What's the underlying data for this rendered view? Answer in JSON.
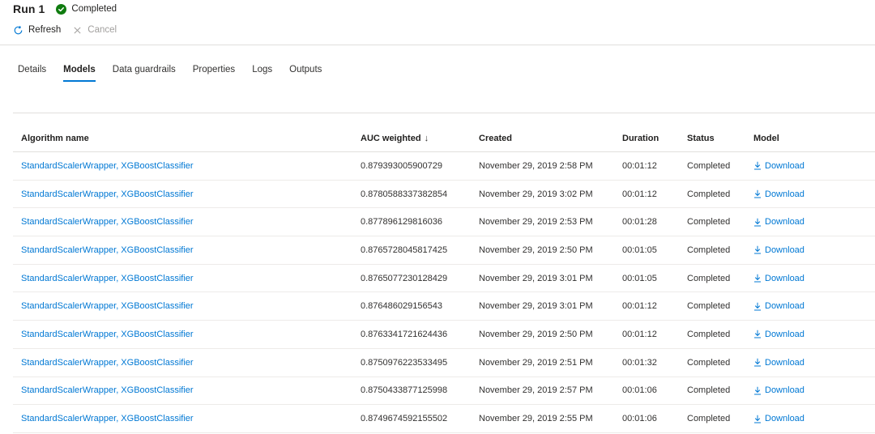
{
  "header": {
    "title": "Run 1",
    "status_label": "Completed",
    "status_color": "#107c10"
  },
  "toolbar": {
    "refresh_label": "Refresh",
    "cancel_label": "Cancel"
  },
  "tabs": [
    {
      "label": "Details",
      "active": false
    },
    {
      "label": "Models",
      "active": true
    },
    {
      "label": "Data guardrails",
      "active": false
    },
    {
      "label": "Properties",
      "active": false
    },
    {
      "label": "Logs",
      "active": false
    },
    {
      "label": "Outputs",
      "active": false
    }
  ],
  "table": {
    "columns": {
      "algorithm": "Algorithm name",
      "auc": "AUC weighted",
      "auc_sort_icon": "arrow-down-icon",
      "created": "Created",
      "duration": "Duration",
      "status": "Status",
      "model": "Model"
    },
    "download_icon": "download-icon",
    "rows": [
      {
        "algorithm": "StandardScalerWrapper, XGBoostClassifier",
        "auc": "0.879393005900729",
        "created": "November 29, 2019 2:58 PM",
        "duration": "00:01:12",
        "status": "Completed",
        "model": "Download"
      },
      {
        "algorithm": "StandardScalerWrapper, XGBoostClassifier",
        "auc": "0.8780588337382854",
        "created": "November 29, 2019 3:02 PM",
        "duration": "00:01:12",
        "status": "Completed",
        "model": "Download"
      },
      {
        "algorithm": "StandardScalerWrapper, XGBoostClassifier",
        "auc": "0.877896129816036",
        "created": "November 29, 2019 2:53 PM",
        "duration": "00:01:28",
        "status": "Completed",
        "model": "Download"
      },
      {
        "algorithm": "StandardScalerWrapper, XGBoostClassifier",
        "auc": "0.8765728045817425",
        "created": "November 29, 2019 2:50 PM",
        "duration": "00:01:05",
        "status": "Completed",
        "model": "Download"
      },
      {
        "algorithm": "StandardScalerWrapper, XGBoostClassifier",
        "auc": "0.8765077230128429",
        "created": "November 29, 2019 3:01 PM",
        "duration": "00:01:05",
        "status": "Completed",
        "model": "Download"
      },
      {
        "algorithm": "StandardScalerWrapper, XGBoostClassifier",
        "auc": "0.876486029156543",
        "created": "November 29, 2019 3:01 PM",
        "duration": "00:01:12",
        "status": "Completed",
        "model": "Download"
      },
      {
        "algorithm": "StandardScalerWrapper, XGBoostClassifier",
        "auc": "0.8763341721624436",
        "created": "November 29, 2019 2:50 PM",
        "duration": "00:01:12",
        "status": "Completed",
        "model": "Download"
      },
      {
        "algorithm": "StandardScalerWrapper, XGBoostClassifier",
        "auc": "0.8750976223533495",
        "created": "November 29, 2019 2:51 PM",
        "duration": "00:01:32",
        "status": "Completed",
        "model": "Download"
      },
      {
        "algorithm": "StandardScalerWrapper, XGBoostClassifier",
        "auc": "0.8750433877125998",
        "created": "November 29, 2019 2:57 PM",
        "duration": "00:01:06",
        "status": "Completed",
        "model": "Download"
      },
      {
        "algorithm": "StandardScalerWrapper, XGBoostClassifier",
        "auc": "0.8749674592155502",
        "created": "November 29, 2019 2:55 PM",
        "duration": "00:01:06",
        "status": "Completed",
        "model": "Download"
      }
    ]
  },
  "colors": {
    "accent": "#0078d4",
    "success": "#107c10",
    "disabled_text": "#a19f9d"
  }
}
